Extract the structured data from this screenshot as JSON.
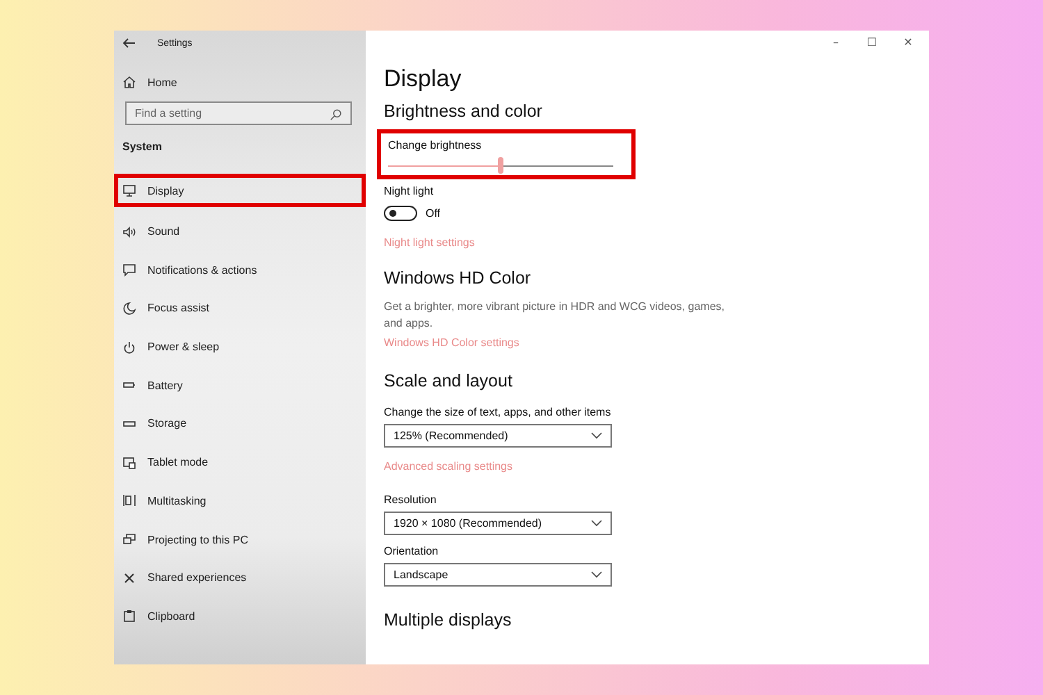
{
  "window": {
    "title": "Settings",
    "controls": [
      "–",
      "☐",
      "✕"
    ]
  },
  "sidebar": {
    "home": "Home",
    "search": {
      "placeholder": "Find a setting"
    },
    "section": "System",
    "items": [
      {
        "label": "Display",
        "selected": true
      },
      {
        "label": "Sound",
        "selected": false
      },
      {
        "label": "Notifications & actions",
        "selected": false
      },
      {
        "label": "Focus assist",
        "selected": false
      },
      {
        "label": "Power & sleep",
        "selected": false
      },
      {
        "label": "Battery",
        "selected": false
      },
      {
        "label": "Storage",
        "selected": false
      },
      {
        "label": "Tablet mode",
        "selected": false
      },
      {
        "label": "Multitasking",
        "selected": false
      },
      {
        "label": "Projecting to this PC",
        "selected": false
      },
      {
        "label": "Shared experiences",
        "selected": false
      },
      {
        "label": "Clipboard",
        "selected": false
      }
    ]
  },
  "content": {
    "title": "Display",
    "brightness": {
      "heading": "Brightness and color",
      "label": "Change brightness",
      "level": 0.5,
      "highlighted": true
    },
    "night_light": {
      "label": "Night light",
      "on": false,
      "state_text": "Off",
      "link": "Night light settings"
    },
    "hd_color": {
      "heading": "Windows HD Color",
      "description": "Get a brighter, more vibrant picture in HDR and WCG videos, games, and apps.",
      "link": "Windows HD Color settings"
    },
    "scale": {
      "heading": "Scale and layout",
      "size_label": "Change the size of text, apps, and other items",
      "size_value": "125% (Recommended)",
      "link": "Advanced scaling settings",
      "resolution_label": "Resolution",
      "resolution_value": "1920 × 1080 (Recommended)",
      "orientation_label": "Orientation",
      "orientation_value": "Landscape"
    },
    "next_heading": "Multiple displays"
  }
}
